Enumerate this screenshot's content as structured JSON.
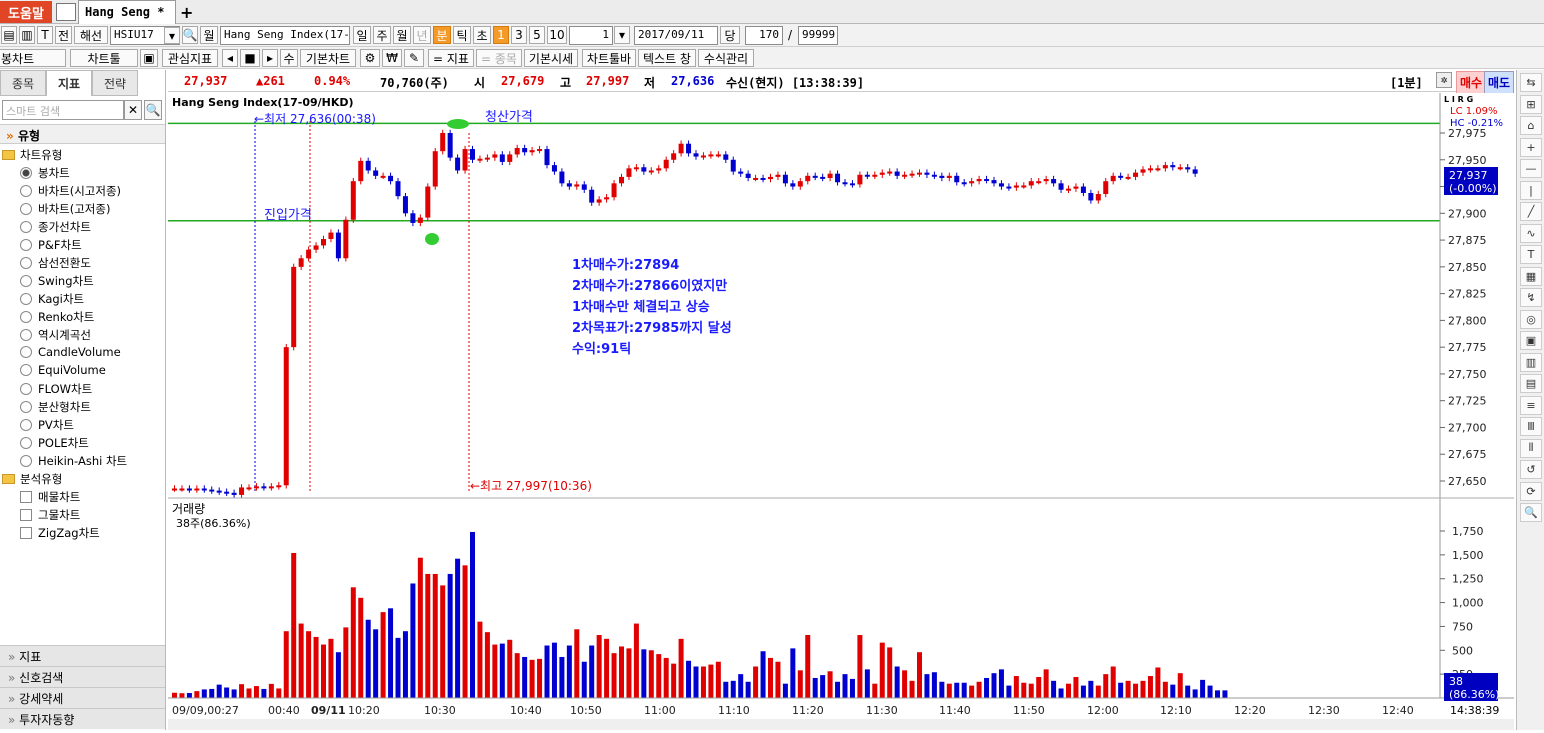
{
  "tabbar": {
    "help": "도움말",
    "tab_title": "Hang Seng *",
    "add": "+"
  },
  "toolbar1": {
    "front": "전",
    "overseas": "해선",
    "code": "HSIU17",
    "monthly": "월",
    "name": "Hang Seng Index(17-09",
    "periods": [
      "일",
      "주",
      "월",
      "년",
      "분",
      "틱",
      "초"
    ],
    "interval_buttons": [
      "1",
      "3",
      "5",
      "10"
    ],
    "interval_value": "1",
    "date": "2017/09/11",
    "dang": "당",
    "count": "170",
    "slash": "/",
    "max": "99999"
  },
  "toolbar2": {
    "candle_chart": "봉차트",
    "chart_tools": "차트툴",
    "fav_indicators": "관심지표",
    "num": "수",
    "basic_chart": "기본차트",
    "won": "₩",
    "eq_indicator": "= 지표",
    "eq_item": "= 종목",
    "basic_quote": "기본시세",
    "chart_toolbar": "차트툴바",
    "text_window": "텍스트 창",
    "formula": "수식관리"
  },
  "leftpanel": {
    "tabs": [
      "종목",
      "지표",
      "전략"
    ],
    "search_placeholder": "스마트 검색",
    "section": "유형",
    "folder1": "차트유형",
    "chart_types": [
      "봉차트",
      "바차트(시고저종)",
      "바차트(고저종)",
      "종가선차트",
      "P&F차트",
      "삼선전환도",
      "Swing차트",
      "Kagi차트",
      "Renko차트",
      "역시계곡선",
      "CandleVolume",
      "EquiVolume",
      "FLOW차트",
      "분산형차트",
      "PV차트",
      "POLE차트",
      "Heikin-Ashi 차트"
    ],
    "folder2": "분석유형",
    "analysis_types": [
      "매물차트",
      "그물차트",
      "ZigZag차트"
    ],
    "bottom_menu": [
      "지표",
      "신호검색",
      "강세약세",
      "투자자동향"
    ]
  },
  "infobar": {
    "price": "27,937",
    "change": "▲261",
    "pct": "0.94%",
    "volume": "70,760(주)",
    "open_label": "시",
    "open": "27,679",
    "high_label": "고",
    "high": "27,997",
    "low_label": "저",
    "low": "27,636",
    "recv": "수신(현지) [13:38:39]",
    "period": "[1분]",
    "buy": "매수",
    "sell": "매도"
  },
  "chart": {
    "title": "Hang Seng Index(17-09/HKD)",
    "low_note": "←최저 27,636(00:38)",
    "high_note": "←최고 27,997(10:36)",
    "settle_label": "청산가격",
    "entry_label": "진입가격",
    "annotation": [
      "1차매수가:27894",
      "2차매수가:27866이였지만",
      "1차매수만 체결되고 상승",
      "2차목표가:27985까지 달성",
      "수익:91틱"
    ],
    "lc": "LC  1.09%",
    "hc": "HC -0.21%",
    "lrg": "L I R G",
    "current_price": "27,937",
    "current_change": "(-0.00%)",
    "price_ticks": [
      "27,975",
      "27,950",
      "27,925",
      "27,900",
      "27,875",
      "27,850",
      "27,825",
      "27,800",
      "27,775",
      "27,750",
      "27,725",
      "27,700",
      "27,675",
      "27,650"
    ],
    "volume_title": "거래량",
    "volume_sub": "38주(86.36%)",
    "volume_ticks": [
      "1,750",
      "1,500",
      "1,250",
      "1,000",
      "750",
      "500",
      "250"
    ],
    "volume_current": "38",
    "volume_current_pct": "(86.36%)",
    "time_labels": [
      "09/09,00:27",
      "00:40",
      "09/11",
      "10:20",
      "10:30",
      "10:40",
      "10:50",
      "11:00",
      "11:10",
      "11:20",
      "11:30",
      "11:40",
      "11:50",
      "12:00",
      "12:10",
      "12:20",
      "12:30",
      "12:40"
    ],
    "clock": "14:38:39",
    "colors": {
      "up": "#e00000",
      "down": "#0000d0",
      "level_line": "#22aa22",
      "marker": "#33cc33",
      "annotation": "#1a1aff"
    }
  },
  "chart_data": {
    "type": "candlestick",
    "title": "Hang Seng Index(17-09/HKD)",
    "ylim": [
      27630,
      27985
    ],
    "levels": {
      "entry_price": 27893,
      "settle_price": 27984
    },
    "extremes": {
      "low": 27636,
      "low_time": "00:38",
      "high": 27997,
      "high_time": "10:36"
    },
    "close_series": [
      27643,
      27643,
      27642,
      27643,
      27642,
      27641,
      27640,
      27639,
      27637,
      27644,
      27644,
      27645,
      27644,
      27645,
      27646,
      27775,
      27850,
      27858,
      27866,
      27870,
      27876,
      27882,
      27858,
      27894,
      27930,
      27949,
      27940,
      27935,
      27935,
      27930,
      27916,
      27900,
      27891,
      27896,
      27925,
      27958,
      27975,
      27952,
      27940,
      27960,
      27950,
      27951,
      27952,
      27955,
      27948,
      27955,
      27961,
      27957,
      27959,
      27960,
      27945,
      27939,
      27928,
      27925,
      27927,
      27922,
      27910,
      27913,
      27915,
      27928,
      27934,
      27942,
      27943,
      27939,
      27940,
      27942,
      27950,
      27956,
      27965,
      27956,
      27953,
      27954,
      27955,
      27955,
      27950,
      27939,
      27937,
      27933,
      27933,
      27932,
      27934,
      27936,
      27928,
      27925,
      27930,
      27935,
      27934,
      27933,
      27937,
      27929,
      27928,
      27927,
      27936,
      27935,
      27936,
      27938,
      27939,
      27935,
      27936,
      27937,
      27938,
      27936,
      27935,
      27933,
      27935,
      27929,
      27928,
      27930,
      27932,
      27931,
      27928,
      27925,
      27924,
      27926,
      27926,
      27930,
      27930,
      27932,
      27928,
      27922,
      27923,
      27925,
      27919,
      27912,
      27918,
      27930,
      27935,
      27934,
      27934,
      27938,
      27941,
      27942,
      27942,
      27945,
      27943,
      27943,
      27941,
      27937
    ],
    "volume_series": [
      55,
      50,
      52,
      72,
      90,
      95,
      140,
      110,
      90,
      145,
      100,
      125,
      95,
      148,
      100,
      700,
      1520,
      780,
      700,
      640,
      560,
      620,
      480,
      740,
      1160,
      1050,
      820,
      720,
      900,
      940,
      630,
      700,
      1200,
      1470,
      1300,
      1300,
      1180,
      1300,
      1460,
      1390,
      1740,
      800,
      690,
      560,
      570,
      610,
      470,
      430,
      400,
      410,
      550,
      580,
      430,
      550,
      720,
      380,
      550,
      660,
      620,
      470,
      540,
      520,
      780,
      510,
      500,
      460,
      420,
      360,
      620,
      390,
      330,
      330,
      350,
      380,
      170,
      180,
      250,
      170,
      330,
      490,
      420,
      380,
      150,
      520,
      290,
      660,
      210,
      240,
      280,
      170,
      250,
      200,
      660,
      300,
      150,
      580,
      530,
      330,
      290,
      180,
      480,
      250,
      270,
      170,
      150,
      160,
      160,
      130,
      170,
      210,
      260,
      300,
      130,
      230,
      160,
      150,
      220,
      300,
      180,
      100,
      150,
      220,
      130,
      180,
      130,
      250,
      330,
      160,
      180,
      150,
      180,
      230,
      320,
      170,
      140,
      260,
      130,
      90,
      190,
      130,
      80,
      80
    ]
  }
}
